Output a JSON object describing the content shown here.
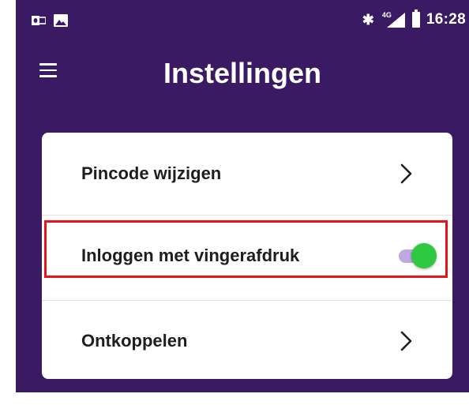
{
  "status_bar": {
    "time": "16:28",
    "network": "4G",
    "left_icons": [
      "outlook-icon",
      "image-icon"
    ],
    "right_icons": [
      "bluetooth-icon",
      "signal-icon",
      "battery-icon"
    ]
  },
  "header": {
    "title": "Instellingen",
    "menu_icon": "hamburger-menu-icon"
  },
  "settings": {
    "items": [
      {
        "label": "Pincode wijzigen",
        "control": "chevron"
      },
      {
        "label": "Inloggen met vingerafdruk",
        "control": "toggle",
        "toggle_on": true
      },
      {
        "label": "Ontkoppelen",
        "control": "chevron"
      }
    ]
  },
  "colors": {
    "header_background": "#3a1a62",
    "highlight_border": "#e8121b",
    "toggle_knob": "#2ec940",
    "toggle_track": "#bfa9e0"
  }
}
